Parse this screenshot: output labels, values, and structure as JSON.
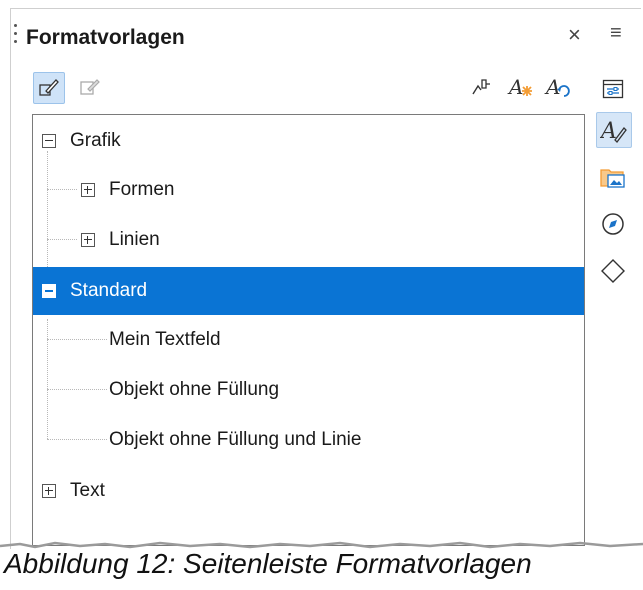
{
  "panel": {
    "title": "Formatvorlagen",
    "close_label": "×",
    "menu_label": "≡"
  },
  "toolbar": {
    "left_icons": [
      "fill-format-mode-icon",
      "new-style-from-selection-disabled-icon"
    ],
    "right_icons": [
      "fill-format-icon",
      "new-style-icon",
      "update-style-icon"
    ]
  },
  "tree": {
    "items": [
      {
        "label": "Grafik",
        "level": 0,
        "expander": "minus"
      },
      {
        "label": "Formen",
        "level": 1,
        "expander": "plus"
      },
      {
        "label": "Linien",
        "level": 1,
        "expander": "plus"
      },
      {
        "label": "Standard",
        "level": 0,
        "expander": "minus",
        "selected": true
      },
      {
        "label": "Mein Textfeld",
        "level": 2
      },
      {
        "label": "Objekt ohne Füllung",
        "level": 2
      },
      {
        "label": "Objekt ohne Füllung und Linie",
        "level": 2
      },
      {
        "label": "Text",
        "level": 0,
        "expander": "plus"
      }
    ]
  },
  "sidebar_tabs": [
    "properties-icon",
    "styles-icon",
    "gallery-icon",
    "navigator-icon",
    "shapes-icon"
  ],
  "caption": "Abbildung 12: Seitenleiste Formatvorlagen",
  "colors": {
    "selection": "#0a74d4",
    "accent_orange": "#f39c34"
  }
}
